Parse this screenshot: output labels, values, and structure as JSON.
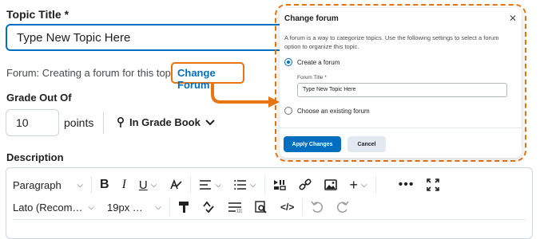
{
  "form": {
    "topic_title_label": "Topic Title *",
    "topic_title_value": "Type New Topic Here",
    "forum_text": "Forum: Creating a forum for this topic",
    "change_forum_link": "Change Forum",
    "grade_label": "Grade Out Of",
    "grade_value": "10",
    "points_label": "points",
    "gradebook_label": "In Grade Book",
    "description_label": "Description"
  },
  "editor": {
    "paragraph_label": "Paragraph",
    "font_label": "Lato (Recom…",
    "size_label": "19px …",
    "icons_row1": [
      "bold-icon",
      "italic-icon",
      "underline-icon",
      "format-icon",
      "align-icon",
      "list-icon",
      "media-icon",
      "link-icon",
      "image-icon",
      "plus-icon",
      "more-icon",
      "fullscreen-icon"
    ],
    "icons_row2": [
      "paint-format-icon",
      "spellcheck-icon",
      "word-count-icon",
      "find-icon",
      "source-code-icon",
      "undo-icon",
      "redo-icon"
    ]
  },
  "dialog": {
    "title": "Change forum",
    "description": "A forum is a way to categorize topics. Use the following settings to select a forum option to organize this topic.",
    "option_create": "Create a forum",
    "forum_title_label": "Forum Title *",
    "forum_title_value": "Type New Topic Here",
    "option_existing": "Choose an existing forum",
    "apply_button": "Apply Changes",
    "cancel_button": "Cancel",
    "selected_option": "create"
  },
  "colors": {
    "accent_blue": "#006fbf",
    "highlight_orange": "#e87511"
  }
}
